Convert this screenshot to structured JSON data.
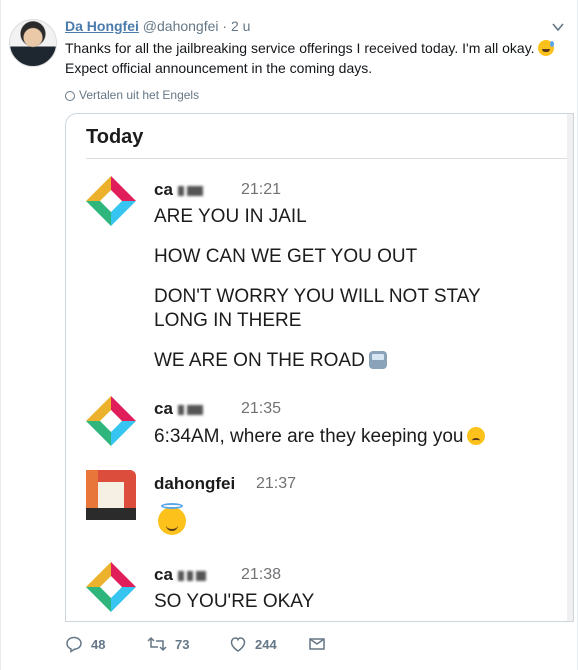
{
  "tweet": {
    "display_name": "Da Hongfei",
    "handle": "@dahongfei",
    "separator": "·",
    "time": "2 u",
    "text": "Thanks for all the jailbreaking service offerings I received today. I'm all okay.",
    "text_line2": "Expect official announcement in the coming days.",
    "translate_label": "Vertalen uit het Engels"
  },
  "card": {
    "header": "Today",
    "messages": [
      {
        "sender": "ca",
        "time": "21:21",
        "lines": [
          "ARE YOU IN JAIL",
          "HOW CAN WE GET YOU OUT",
          "DON'T WORRY YOU WILL NOT STAY LONG IN THERE",
          "WE ARE ON THE ROAD"
        ],
        "emoji": "bus-icon"
      },
      {
        "sender": "ca",
        "time": "21:35",
        "lines": [
          "6:34AM, where are they keeping you"
        ],
        "emoji": "sad-face-icon"
      },
      {
        "sender": "dahongfei",
        "time": "21:37",
        "lines": [],
        "emoji": "angel-face-icon"
      },
      {
        "sender": "ca",
        "time": "21:38",
        "lines": [
          "SO YOU'RE OKAY"
        ]
      }
    ]
  },
  "actions": {
    "reply_count": "48",
    "retweet_count": "73",
    "like_count": "244"
  }
}
